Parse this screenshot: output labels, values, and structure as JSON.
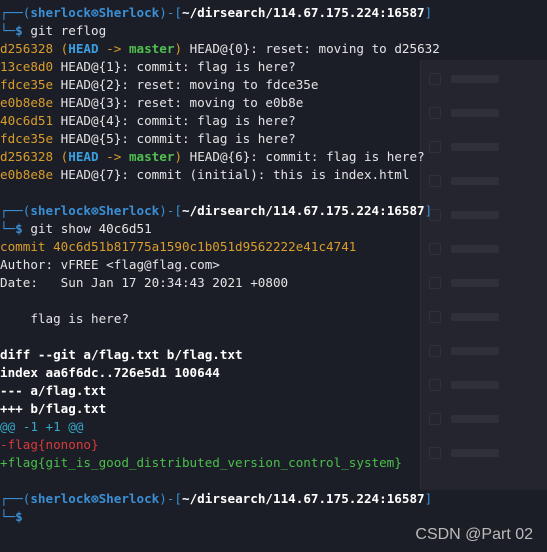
{
  "prompt": {
    "user_host": "sherlock⊗Sherlock",
    "path": "~/dirsearch/114.67.175.224:16587",
    "dollar": "$"
  },
  "commands": {
    "reflog": "git reflog",
    "show": "git show 40c6d51"
  },
  "reflog": [
    {
      "hash": "d256328",
      "decor": true,
      "head": "HEAD",
      "arrow": " -> ",
      "branch": "master",
      "text": " HEAD@{0}: reset: moving to d25632"
    },
    {
      "hash": "13ce8d0",
      "decor": false,
      "text": " HEAD@{1}: commit: flag is here?"
    },
    {
      "hash": "fdce35e",
      "decor": false,
      "text": " HEAD@{2}: reset: moving to fdce35e"
    },
    {
      "hash": "e0b8e8e",
      "decor": false,
      "text": " HEAD@{3}: reset: moving to e0b8e"
    },
    {
      "hash": "40c6d51",
      "decor": false,
      "text": " HEAD@{4}: commit: flag is here?"
    },
    {
      "hash": "fdce35e",
      "decor": false,
      "text": " HEAD@{5}: commit: flag is here?"
    },
    {
      "hash": "d256328",
      "decor": true,
      "head": "HEAD",
      "arrow": " -> ",
      "branch": "master",
      "text": " HEAD@{6}: commit: flag is here?"
    },
    {
      "hash": "e0b8e8e",
      "decor": false,
      "text": " HEAD@{7}: commit (initial): this is index.html"
    }
  ],
  "show": {
    "commit": "commit 40c6d51b81775a1590c1b051d9562222e41c4741",
    "author": "Author: vFREE <flag@flag.com>",
    "date": "Date:   Sun Jan 17 20:34:43 2021 +0800",
    "message": "    flag is here?",
    "diff_header": "diff --git a/flag.txt b/flag.txt",
    "index": "index aa6f6dc..726e5d1 100644",
    "minus_file": "--- a/flag.txt",
    "plus_file": "+++ b/flag.txt",
    "hunk": "@@ -1 +1 @@",
    "removed": "-flag{nonono}",
    "added": "+flag{git_is_good_distributed_version_control_system}"
  },
  "watermark": "CSDN @Part 02"
}
